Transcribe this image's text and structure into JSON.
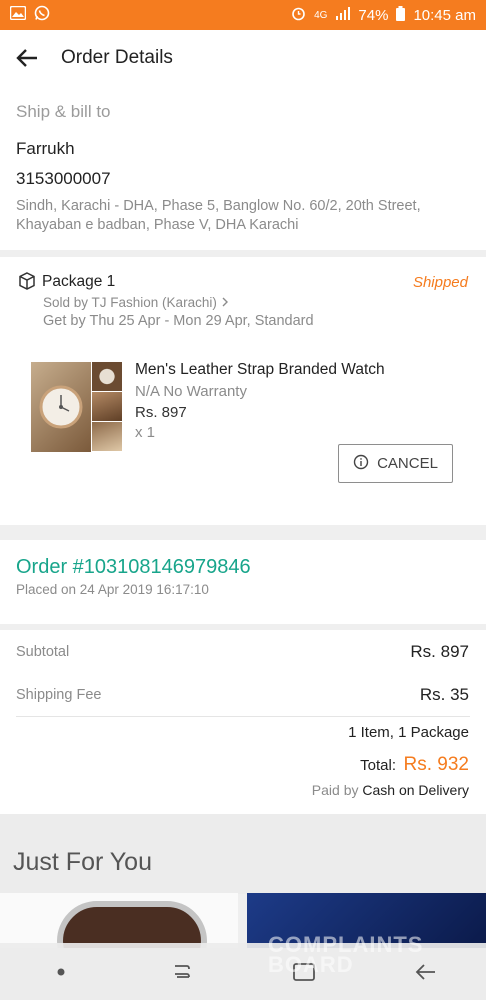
{
  "status_bar": {
    "network": "4G",
    "battery": "74%",
    "time": "10:45 am"
  },
  "header": {
    "title": "Order Details"
  },
  "shipping": {
    "title": "Ship & bill to",
    "name": "Farrukh",
    "phone": "3153000007",
    "address": "Sindh, Karachi - DHA, Phase 5, Banglow No. 60/2, 20th Street, Khayaban e badban, Phase V, DHA Karachi"
  },
  "package": {
    "title": "Package 1",
    "status": "Shipped",
    "seller": "Sold by TJ Fashion (Karachi)",
    "delivery": "Get by Thu 25 Apr - Mon 29 Apr, Standard",
    "item": {
      "name": "Men's Leather Strap Branded Watch",
      "warranty": "N/A No Warranty",
      "price": "Rs. 897",
      "quantity": "x 1"
    },
    "cancel_label": "CANCEL"
  },
  "order": {
    "number": "Order #103108146979846",
    "placed": "Placed on 24 Apr 2019  16:17:10"
  },
  "summary": {
    "subtotal_label": "Subtotal",
    "subtotal_value": "Rs. 897",
    "shipping_label": "Shipping Fee",
    "shipping_value": "Rs. 35",
    "items_count": "1 Item, 1 Package",
    "total_label": "Total:",
    "total_value": "Rs. 932",
    "paid_by_label": "Paid by",
    "paid_by_value": "Cash on Delivery"
  },
  "just_for_you": {
    "title": "Just For You"
  },
  "watermark": {
    "line1": "COMPLAINTS",
    "line2": "BOARD"
  },
  "colors": {
    "accent": "#f57c1f",
    "order_number": "#18a58b"
  }
}
